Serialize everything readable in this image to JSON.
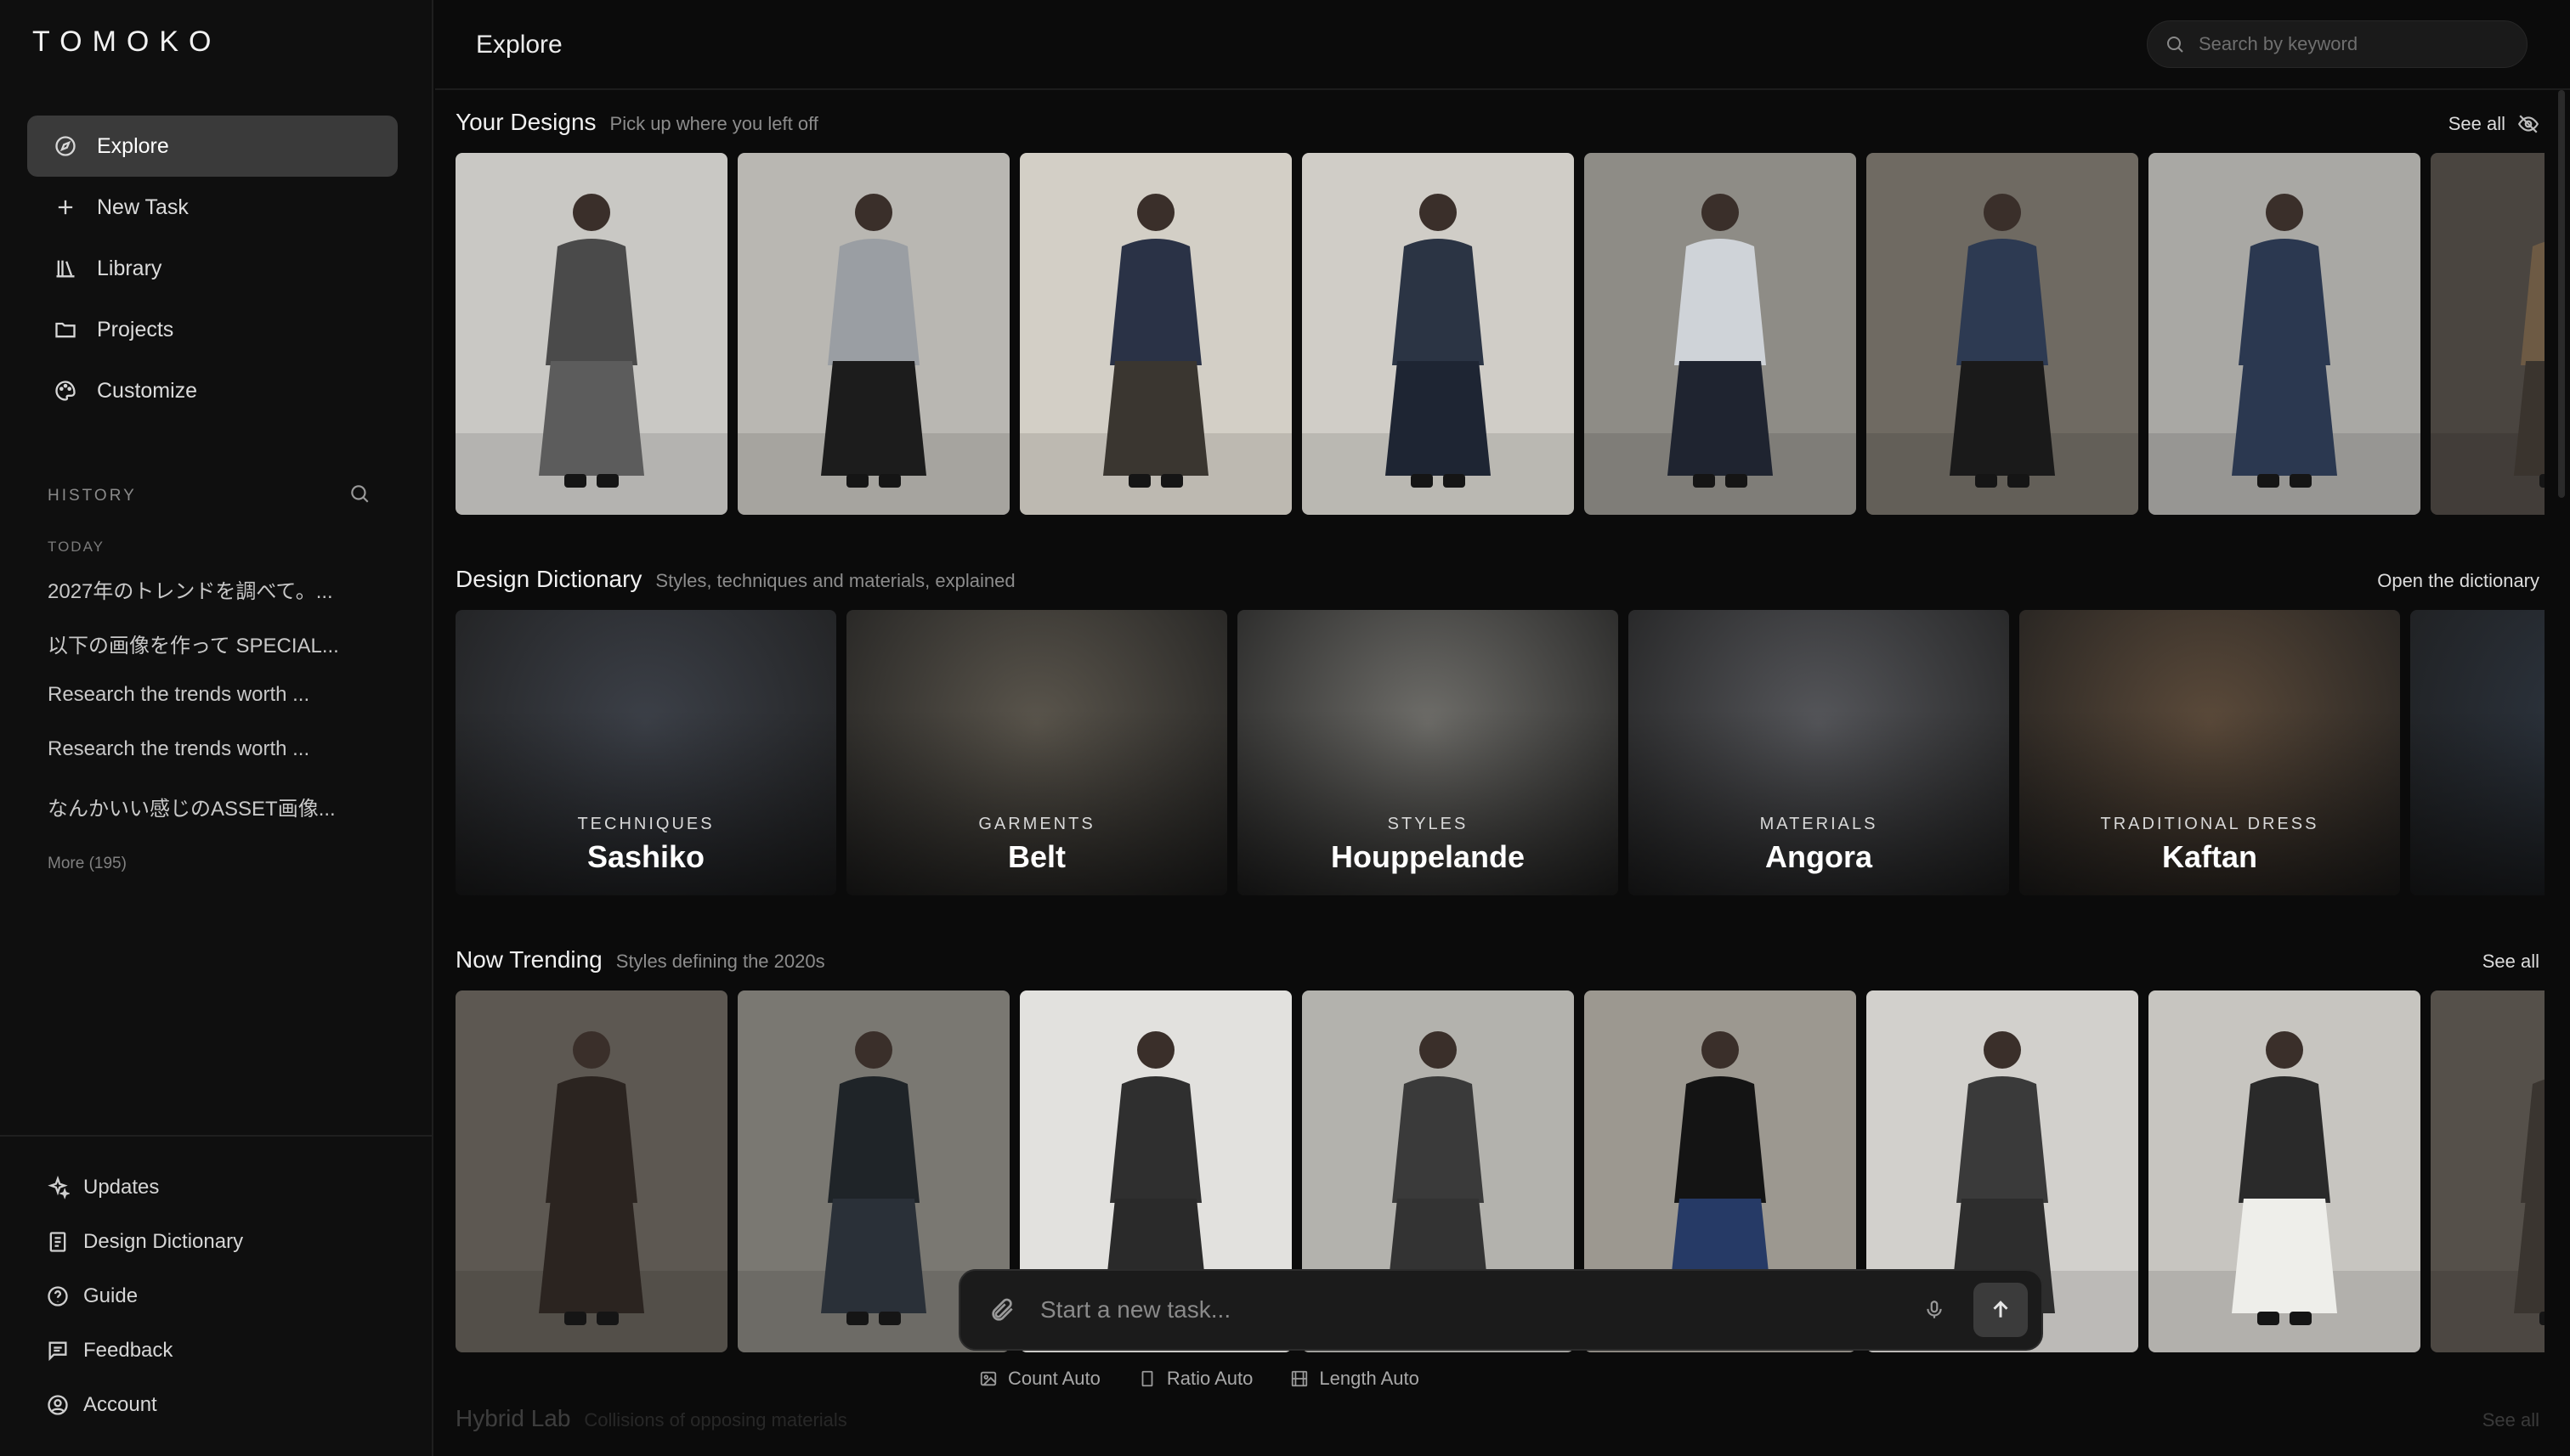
{
  "app": {
    "logo": "TOMOKO"
  },
  "sidebar": {
    "nav": [
      {
        "label": "Explore",
        "icon": "compass-icon",
        "active": true
      },
      {
        "label": "New Task",
        "icon": "plus-icon"
      },
      {
        "label": "Library",
        "icon": "library-icon"
      },
      {
        "label": "Projects",
        "icon": "folder-icon"
      },
      {
        "label": "Customize",
        "icon": "palette-icon"
      }
    ],
    "history_label": "HISTORY",
    "today_label": "TODAY",
    "history": [
      "2027年のトレンドを調べて。...",
      "以下の画像を作って SPECIAL...",
      "Research the trends worth ...",
      "Research the trends worth ...",
      "なんかいい感じのASSET画像..."
    ],
    "more": "More (195)",
    "footer": [
      {
        "label": "Updates",
        "icon": "sparkle-icon"
      },
      {
        "label": "Design Dictionary",
        "icon": "book-icon"
      },
      {
        "label": "Guide",
        "icon": "help-circle-icon"
      },
      {
        "label": "Feedback",
        "icon": "message-icon"
      },
      {
        "label": "Account",
        "icon": "user-circle-icon"
      }
    ]
  },
  "header": {
    "title": "Explore",
    "search_placeholder": "Search by keyword"
  },
  "sections": {
    "your_designs": {
      "title": "Your Designs",
      "subtitle": "Pick up where you left off",
      "link": "See all"
    },
    "dictionary": {
      "title": "Design Dictionary",
      "subtitle": "Styles, techniques and materials, explained",
      "link": "Open the dictionary"
    },
    "trending": {
      "title": "Now Trending",
      "subtitle": "Styles defining the 2020s",
      "link": "See all"
    },
    "hybrid": {
      "title": "Hybrid Lab",
      "subtitle": "Collisions of opposing materials",
      "link": "See all"
    }
  },
  "dictionary_cards": [
    {
      "category": "TECHNIQUES",
      "name": "Sashiko",
      "tone": "#3c4048"
    },
    {
      "category": "GARMENTS",
      "name": "Belt",
      "tone": "#5a554c"
    },
    {
      "category": "STYLES",
      "name": "Houppelande",
      "tone": "#6e6d69"
    },
    {
      "category": "MATERIALS",
      "name": "Angora",
      "tone": "#55565a"
    },
    {
      "category": "TRADITIONAL DRESS",
      "name": "Kaftan",
      "tone": "#5b4a3a"
    },
    {
      "category": "",
      "name": "",
      "tone": "#2d3540"
    }
  ],
  "design_cards": [
    {
      "bg": "#c9c8c4",
      "fig": "#4a4a4a",
      "accent": "#5c5c5c"
    },
    {
      "bg": "#b9b7b2",
      "fig": "#9a9ea3",
      "accent": "#1c1c1c"
    },
    {
      "bg": "#d3cfc6",
      "fig": "#2a3246",
      "accent": "#3a3630"
    },
    {
      "bg": "#d0cdc7",
      "fig": "#2b3444",
      "accent": "#1e2533"
    },
    {
      "bg": "#8e8c86",
      "fig": "#cfd3d8",
      "accent": "#1f2430"
    },
    {
      "bg": "#6f6a62",
      "fig": "#2d3a52",
      "accent": "#1a1a1a"
    },
    {
      "bg": "#a9a8a4",
      "fig": "#2b3850",
      "accent": "#2b3850"
    },
    {
      "bg": "#4a4540",
      "fig": "#6d5a44",
      "accent": "#3a342e"
    }
  ],
  "trending_cards": [
    {
      "bg": "#5d5852",
      "fig": "#2b2420",
      "accent": "#2b2420"
    },
    {
      "bg": "#7a7872",
      "fig": "#1f2428",
      "accent": "#2a3038"
    },
    {
      "bg": "#e2e1de",
      "fig": "#2f2f2f",
      "accent": "#2a2a2a"
    },
    {
      "bg": "#b3b2ad",
      "fig": "#3a3a3a",
      "accent": "#333333"
    },
    {
      "bg": "#9c9890",
      "fig": "#141414",
      "accent": "#263a66"
    },
    {
      "bg": "#d2d0cc",
      "fig": "#3a3a3a",
      "accent": "#2d2d2d"
    },
    {
      "bg": "#c7c5c0",
      "fig": "#2a2a2a",
      "accent": "#eeeeea"
    },
    {
      "bg": "#55504a",
      "fig": "#3a3530",
      "accent": "#3a3530"
    }
  ],
  "composer": {
    "placeholder": "Start a new task...",
    "options": [
      {
        "label": "Count Auto",
        "icon": "image-icon"
      },
      {
        "label": "Ratio Auto",
        "icon": "ratio-icon"
      },
      {
        "label": "Length Auto",
        "icon": "film-icon"
      }
    ]
  }
}
